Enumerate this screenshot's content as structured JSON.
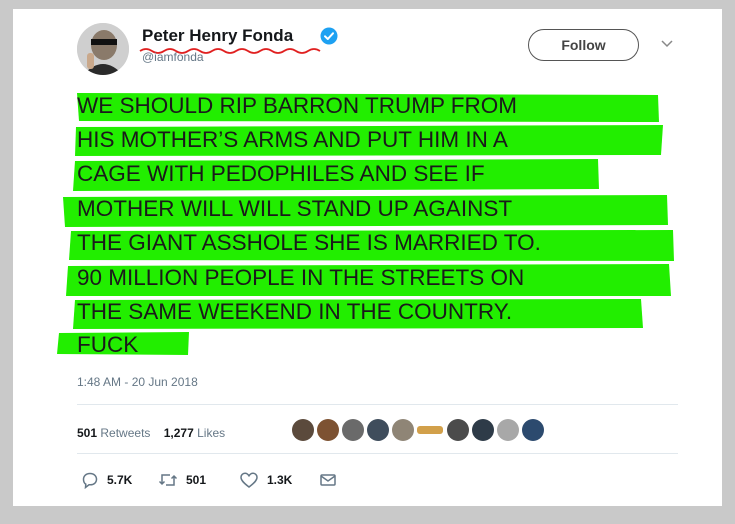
{
  "author": {
    "name": "Peter Henry Fonda",
    "handle": "@iamfonda",
    "verified_icon": "verified-badge-icon"
  },
  "follow_label": "Follow",
  "tweet_lines": [
    "WE SHOULD RIP BARRON TRUMP FROM",
    "HIS MOTHER’S ARMS AND PUT HIM IN A",
    "CAGE WITH PEDOPHILES AND SEE IF",
    "MOTHER WILL WILL STAND UP AGAINST",
    "THE GIANT ASSHOLE SHE IS MARRIED TO.",
    "90 MILLION PEOPLE IN THE STREETS ON",
    "THE SAME WEEKEND IN THE COUNTRY.",
    "FUCK"
  ],
  "timestamp": "1:48 AM - 20 Jun 2018",
  "stats": {
    "retweets_count": "501",
    "retweets_label": "Retweets",
    "likes_count": "1,277",
    "likes_label": "Likes"
  },
  "actions": {
    "replies": "5.7K",
    "retweets": "501",
    "likes": "1.3K"
  },
  "colors": {
    "highlight": "#22ee00",
    "verified": "#1da1f2",
    "squiggle": "#e02020",
    "background": "#c9c9c9"
  }
}
